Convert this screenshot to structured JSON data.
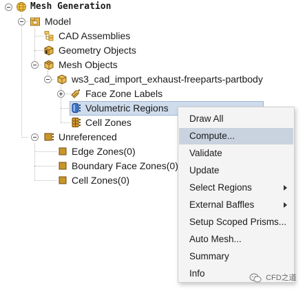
{
  "tree": {
    "root": {
      "label": "Mesh Generation",
      "icon": "globe-icon"
    },
    "model": {
      "label": "Model",
      "icon": "model-folder-icon"
    },
    "cad_assemblies": {
      "label": "CAD Assemblies",
      "icon": "cad-assemblies-icon"
    },
    "geometry_objects": {
      "label": "Geometry Objects",
      "icon": "geometry-objects-icon"
    },
    "mesh_objects": {
      "label": "Mesh Objects",
      "icon": "mesh-objects-icon"
    },
    "mesh_object": {
      "label": "ws3_cad_import_exhaust-freeparts-partbody",
      "icon": "mesh-object-icon"
    },
    "face_zone_labels": {
      "label": "Face Zone Labels",
      "icon": "face-zone-labels-icon"
    },
    "volumetric_regions": {
      "label": "Volumetric Regions",
      "icon": "volumetric-regions-icon"
    },
    "cell_zones": {
      "label": "Cell Zones",
      "icon": "cell-zones-icon"
    },
    "unreferenced": {
      "label": "Unreferenced",
      "icon": "unreferenced-icon"
    },
    "edge_zones": {
      "label": "Edge Zones(0)",
      "icon": "edge-zones-icon"
    },
    "boundary_face_zones": {
      "label": "Boundary Face Zones(0)",
      "icon": "boundary-face-zones-icon"
    },
    "unref_cell_zones": {
      "label": "Cell Zones(0)",
      "icon": "unref-cell-zones-icon"
    }
  },
  "context_menu": {
    "highlighted_item": "Compute...",
    "items": [
      {
        "label": "Draw All",
        "submenu": false
      },
      {
        "label": "Compute...",
        "submenu": false
      },
      {
        "label": "Validate",
        "submenu": false
      },
      {
        "label": "Update",
        "submenu": false
      },
      {
        "label": "Select Regions",
        "submenu": true
      },
      {
        "label": "External Baffles",
        "submenu": true
      },
      {
        "label": "Setup Scoped Prisms...",
        "submenu": false
      },
      {
        "label": "Auto Mesh...",
        "submenu": false
      },
      {
        "label": "Summary",
        "submenu": false
      },
      {
        "label": "Info",
        "submenu": false
      }
    ]
  },
  "watermark": {
    "text": "CFD之道"
  },
  "colors": {
    "selection": "#cfdcec",
    "menu_highlight": "#c9d3df",
    "zone_icon": "#c9962a"
  }
}
